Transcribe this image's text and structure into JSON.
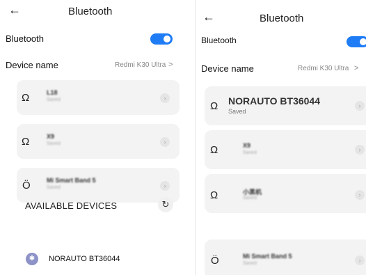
{
  "left": {
    "header": {
      "back_icon": "←",
      "title": "Bluetooth"
    },
    "bluetooth_label": "Bluetooth",
    "device_name_label": "Device name",
    "device_name_value": "Redmi K30 Ultra",
    "chevron": ">",
    "devices": [
      {
        "name": "L18",
        "status": "Saved",
        "icon": "headphones-icon"
      },
      {
        "name": "X9",
        "status": "Saved",
        "icon": "headphones-icon"
      },
      {
        "name": "Mi Smart Band 5",
        "status": "Saved",
        "icon": "watch-icon"
      }
    ],
    "available_label": "AVAILABLE DEVICES",
    "available": [
      {
        "name": "NORAUTO BT36044"
      }
    ]
  },
  "right": {
    "header": {
      "back_icon": "←",
      "title": "Bluetooth"
    },
    "bluetooth_label": "Bluetooth",
    "device_name_label": "Device name",
    "device_name_value": "Redmi K30 Ultra",
    "chevron": ">",
    "devices": [
      {
        "name": "NORAUTO BT36044",
        "status": "Saved",
        "icon": "headphones-icon"
      },
      {
        "name": "X9",
        "status": "Saved",
        "icon": "headphones-icon"
      },
      {
        "name": "小黑机",
        "status": "Saved",
        "icon": "headphones-icon"
      },
      {
        "name": "Mi Smart Band 5",
        "status": "Saved",
        "icon": "watch-icon"
      }
    ]
  },
  "colors": {
    "accent": "#1f7cf5",
    "card": "#f3f3f3",
    "bt_badge": "#8d93c7"
  }
}
